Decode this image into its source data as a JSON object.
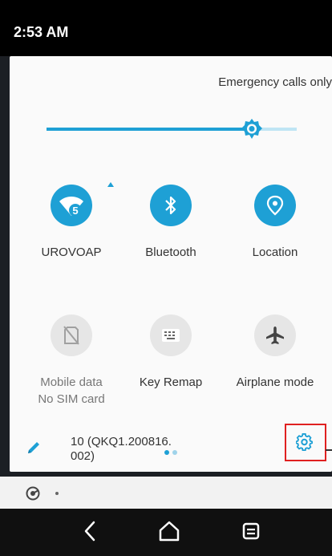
{
  "status_bar": {
    "time": "2:53 AM"
  },
  "panel": {
    "emergency_text": "Emergency calls only",
    "brightness_level": 0.82,
    "tiles_row1": [
      {
        "label": "UROVOAP",
        "icon": "wifi-icon",
        "badge": "5",
        "state": "on"
      },
      {
        "label": "Bluetooth",
        "icon": "bluetooth-icon",
        "state": "on"
      },
      {
        "label": "Location",
        "icon": "location-icon",
        "state": "on"
      }
    ],
    "tiles_row2": [
      {
        "label": "Mobile data",
        "sub": "No SIM card",
        "icon": "no-sim-icon",
        "state": "off"
      },
      {
        "label": "Key Remap",
        "icon": "keyboard-icon",
        "state": "off"
      },
      {
        "label": "Airplane mode",
        "icon": "airplane-icon",
        "state": "off"
      }
    ],
    "build_line1": "10 (QKQ1.200816.",
    "build_line2": "002)"
  },
  "colors": {
    "accent": "#1ea0d5",
    "highlight_box": "#e02020"
  }
}
